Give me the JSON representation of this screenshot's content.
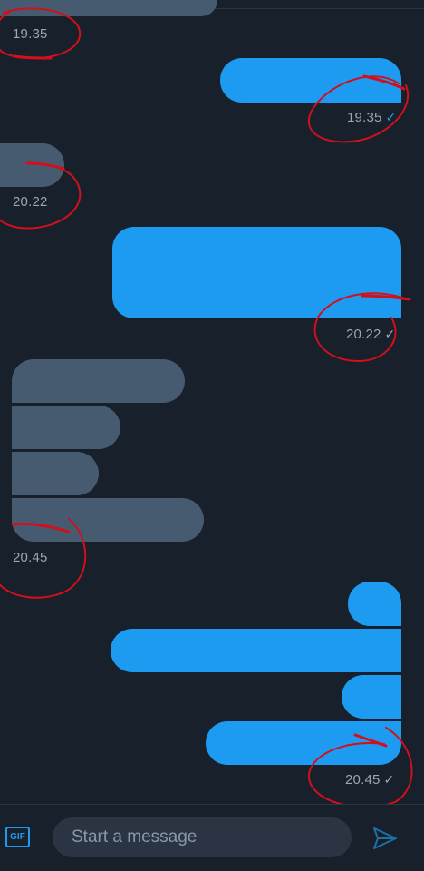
{
  "header": {
    "handle_hint": "@"
  },
  "messages": [
    {
      "direction": "incoming",
      "time": "19.35"
    },
    {
      "direction": "outgoing",
      "time": "19.35",
      "read_check": "✓"
    },
    {
      "direction": "incoming",
      "time": "20.22"
    },
    {
      "direction": "outgoing",
      "time": "20.22",
      "read_check": "✓"
    },
    {
      "direction": "incoming",
      "time": "20.45"
    },
    {
      "direction": "outgoing",
      "time": "20.45",
      "read_check": "✓"
    }
  ],
  "composer": {
    "gif_label": "GIF",
    "placeholder": "Start a message",
    "send_icon": "send-icon"
  },
  "colors": {
    "background": "#17202b",
    "incoming_bubble": "#475b70",
    "outgoing_bubble": "#1d9bf0",
    "annotation": "#d0101c"
  }
}
